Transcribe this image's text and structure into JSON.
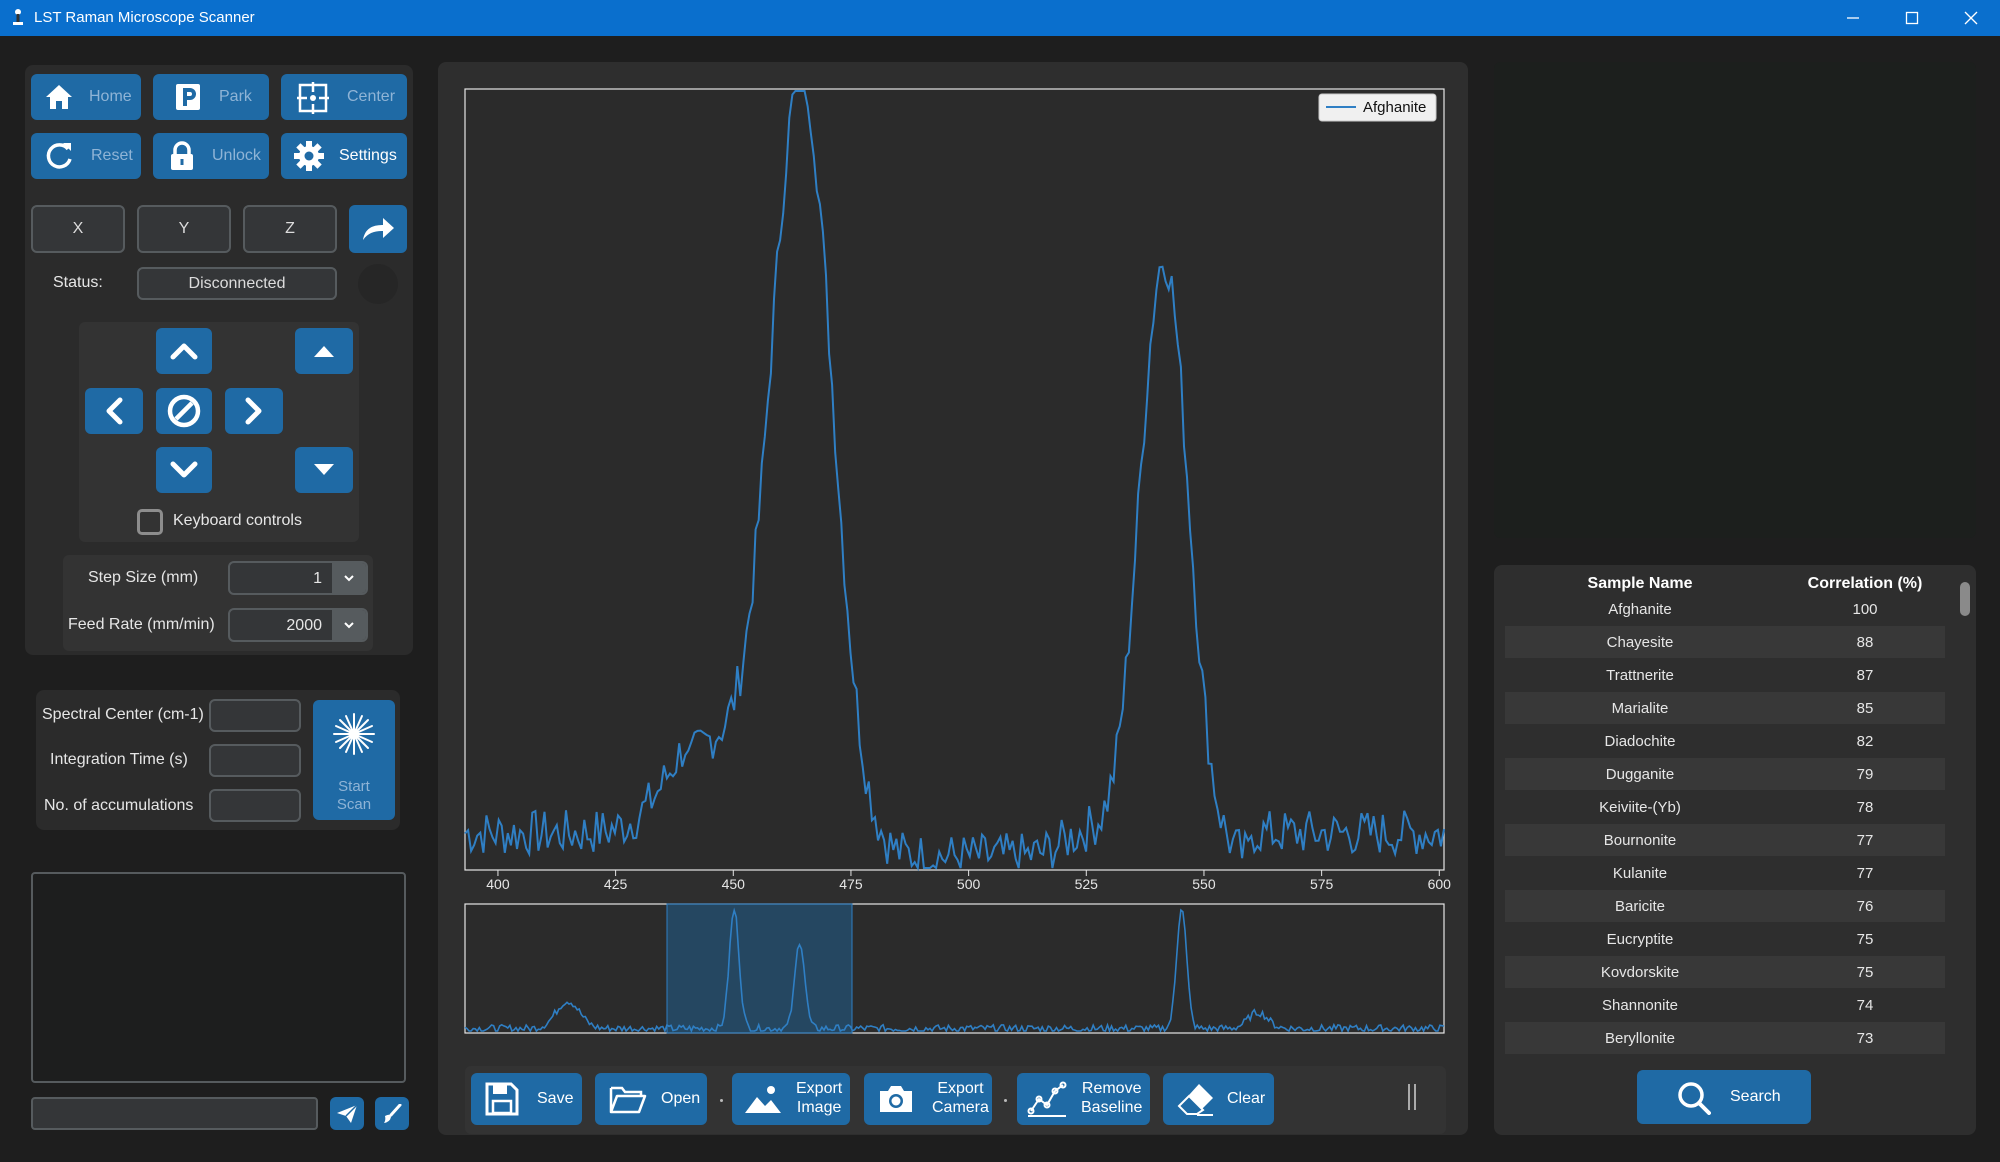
{
  "window": {
    "title": "LST Raman Microscope Scanner"
  },
  "machine_buttons": {
    "home": "Home",
    "park": "Park",
    "center": "Center",
    "reset": "Reset",
    "unlock": "Unlock",
    "settings": "Settings"
  },
  "coords": {
    "x": "X",
    "y": "Y",
    "z": "Z"
  },
  "status": {
    "label": "Status:",
    "value": "Disconnected"
  },
  "jog": {
    "keyboard_label": "Keyboard controls",
    "keyboard_checked": false
  },
  "motion": {
    "step_label": "Step Size (mm)",
    "step_value": "1",
    "feed_label": "Feed Rate (mm/min)",
    "feed_value": "2000"
  },
  "scan": {
    "center_label": "Spectral Center (cm-1)",
    "integration_label": "Integration Time (s)",
    "accum_label": "No. of accumulations",
    "start_line1": "Start",
    "start_line2": "Scan",
    "center_value": "",
    "integration_value": "",
    "accum_value": ""
  },
  "console": {
    "input_value": ""
  },
  "toolbar": {
    "save": "Save",
    "open": "Open",
    "export_image_1": "Export",
    "export_image_2": "Image",
    "export_camera_1": "Export",
    "export_camera_2": "Camera",
    "remove_baseline_1": "Remove",
    "remove_baseline_2": "Baseline",
    "clear": "Clear"
  },
  "results": {
    "headers": [
      "Sample Name",
      "Correlation (%)"
    ],
    "rows": [
      [
        "Afghanite",
        "100"
      ],
      [
        "Chayesite",
        "88"
      ],
      [
        "Trattnerite",
        "87"
      ],
      [
        "Marialite",
        "85"
      ],
      [
        "Diadochite",
        "82"
      ],
      [
        "Dugganite",
        "79"
      ],
      [
        "Keiviite-(Yb)",
        "78"
      ],
      [
        "Bournonite",
        "77"
      ],
      [
        "Kulanite",
        "77"
      ],
      [
        "Baricite",
        "76"
      ],
      [
        "Eucryptite",
        "75"
      ],
      [
        "Kovdorskite",
        "75"
      ],
      [
        "Shannonite",
        "74"
      ],
      [
        "Beryllonite",
        "73"
      ]
    ],
    "search_label": "Search"
  },
  "colors": {
    "accent": "#1f6aa5",
    "line": "#2f7fc4",
    "titlebar": "#0a6fcd"
  },
  "chart_data": {
    "type": "line",
    "title": "",
    "xlabel": "",
    "ylabel": "",
    "xlim": [
      393,
      601
    ],
    "ylim": [
      0,
      1
    ],
    "xticks": [
      400,
      425,
      450,
      475,
      500,
      525,
      550,
      575,
      600
    ],
    "legend": "top-right",
    "series": [
      {
        "name": "Afghanite",
        "peaks": [
          {
            "center": 464.5,
            "height": 1.0
          },
          {
            "center": 541.5,
            "height": 0.77
          }
        ]
      }
    ],
    "overview": {
      "selected_range": "middle-left",
      "peaks": [
        "small near left",
        "two peaks in selection",
        "one peak right of center",
        "small bump right"
      ]
    }
  }
}
